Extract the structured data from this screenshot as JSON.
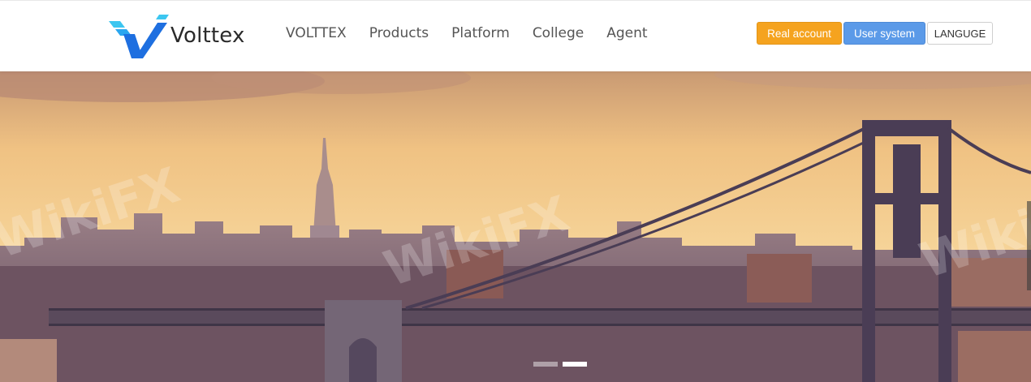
{
  "header": {
    "logo_text": "Volttex",
    "nav": [
      "VOLTTEX",
      "Products",
      "Platform",
      "College",
      "Agent"
    ],
    "buttons": {
      "real_account": "Real account",
      "user_system": "User system",
      "language": "LANGUGE"
    }
  },
  "hero": {
    "watermark": "WikiFX",
    "slides": 2,
    "active_slide": 2
  },
  "colors": {
    "accent_orange": "#f5a31f",
    "accent_blue": "#5b9ae8",
    "logo_blue": "#1e6fe0",
    "logo_cyan": "#3cc6f0"
  }
}
